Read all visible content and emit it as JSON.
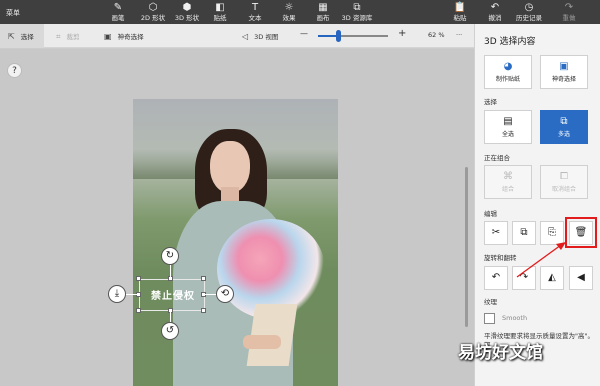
{
  "topbar": {
    "menu_label": "菜单",
    "tools": [
      {
        "label": "画笔",
        "icon": "brush-icon"
      },
      {
        "label": "2D 形状",
        "icon": "2d-shape-icon"
      },
      {
        "label": "3D 形状",
        "icon": "3d-shape-icon"
      },
      {
        "label": "贴纸",
        "icon": "sticker-icon"
      },
      {
        "label": "文本",
        "icon": "text-icon"
      },
      {
        "label": "效果",
        "icon": "effects-icon"
      },
      {
        "label": "画布",
        "icon": "canvas-icon"
      },
      {
        "label": "3D 资源库",
        "icon": "3d-library-icon"
      }
    ],
    "right_tools": [
      {
        "label": "粘贴",
        "icon": "paste-icon"
      },
      {
        "label": "撤消",
        "icon": "undo-icon"
      },
      {
        "label": "历史记录",
        "icon": "history-icon"
      },
      {
        "label": "重做",
        "icon": "redo-icon"
      }
    ]
  },
  "subbar": {
    "select_label": "选择",
    "crop_label": "裁剪",
    "magic_select_label": "神奇选择",
    "view3d_label": "3D 视图",
    "zoom_minus": "—",
    "zoom_plus": "+",
    "zoom_value": "62 %",
    "zoom_fraction": 0.3,
    "more": "···"
  },
  "canvas": {
    "help": "?",
    "watermark_text": "禁止侵权"
  },
  "panel": {
    "title": "3D 选择内容",
    "sticker_label": "制作贴纸",
    "magic_label": "神奇选择",
    "select_section": "选择",
    "select_all_label": "全选",
    "multi_select_label": "多选",
    "group_section": "正在组合",
    "group_label": "组合",
    "ungroup_label": "取消组合",
    "edit_section": "编辑",
    "rotate_section": "旋转和翻转",
    "texture_section": "纹理",
    "smooth_label": "Smooth",
    "note": "平滑纹理要求将显示质量设置为\"高\"。可"
  },
  "overlay": {
    "site_watermark": "易坊好文馆"
  },
  "colors": {
    "accent": "#2a6cc4",
    "highlight": "#e21c1c",
    "toolbar": "#3f3f3f"
  }
}
